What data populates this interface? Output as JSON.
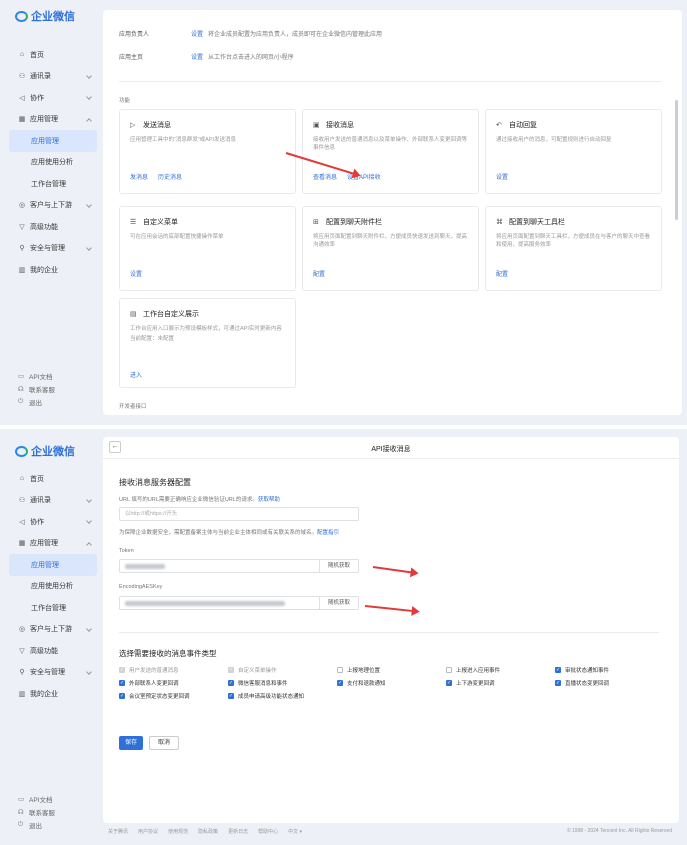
{
  "brand": "企业微信",
  "nav": [
    {
      "label": "首页",
      "icon": "home-icon"
    },
    {
      "label": "通讯录",
      "icon": "contacts-icon"
    },
    {
      "label": "协作",
      "icon": "collab-icon"
    },
    {
      "label": "应用管理",
      "icon": "apps-icon"
    },
    {
      "label": "应用管理",
      "icon": ""
    },
    {
      "label": "应用使用分析",
      "icon": ""
    },
    {
      "label": "工作台管理",
      "icon": ""
    },
    {
      "label": "客户与上下游",
      "icon": "customer-icon"
    },
    {
      "label": "高级功能",
      "icon": "advanced-icon"
    },
    {
      "label": "安全与管理",
      "icon": "security-icon"
    },
    {
      "label": "我的企业",
      "icon": "company-icon"
    }
  ],
  "bottom_links": [
    "API文档",
    "联系客服",
    "退出"
  ],
  "panel1": {
    "owner_label": "应用负责人",
    "owner_link": "设置",
    "owner_desc": "将企业成员配置为应用负责人，成员即可在企业微信内管理此应用",
    "home_label": "应用主页",
    "home_link": "设置",
    "home_desc": "从工作台点击进入的网页/小程序",
    "section_features": "功能",
    "section_dev": "开发者接口",
    "cards": [
      {
        "title": "发送消息",
        "desc": "应用管理工具中的“消息群发”或API发送消息",
        "links": [
          "发消息",
          "历史消息"
        ]
      },
      {
        "title": "接收消息",
        "desc": "接收用户发送的普通消息以及菜单操作、外部联系人变更回调等事件信息",
        "links": [
          "查看消息",
          "设置API接收"
        ]
      },
      {
        "title": "自动回复",
        "desc": "通过接收用户的消息，可配置规则进行自动回复",
        "links": [
          "设置"
        ]
      },
      {
        "title": "自定义菜单",
        "desc": "可在应用会话的底部配置快捷操作菜单",
        "links": [
          "设置"
        ]
      },
      {
        "title": "配置到聊天附件栏",
        "desc": "将应用页面配置到聊天附件栏，方便成员快速发送到聊天，提高沟通效率",
        "links": [
          "配置"
        ]
      },
      {
        "title": "配置到聊天工具栏",
        "desc": "将应用页面配置到聊天工具栏，方便成员在与客户的聊天中查看和使用，提高服务效率",
        "links": [
          "配置"
        ]
      },
      {
        "title": "工作台自定义展示",
        "desc": "工作台应用入口展示为预设模板样式，可通过API实时更新内容",
        "extra": "当前配置：未配置",
        "links": [
          "进入"
        ]
      }
    ]
  },
  "panel2": {
    "title": "API接收消息",
    "heading": "接收消息服务器配置",
    "url_hint": "URL  填写的URL需要正确响应企业微信验证URL的请求。",
    "url_help": "获取帮助",
    "url_placeholder": "以http://或https://开头",
    "domain_note": "为保障企业数据安全，需配置备案主体与当前企业主体相同或有关联关系的域名。",
    "domain_link": "配置指引",
    "token_label": "Token",
    "aes_label": "EncodingAESKey",
    "random_btn": "随机获取",
    "events_heading": "选择需要接收的消息事件类型",
    "events": [
      [
        {
          "label": "用户发送的普通消息",
          "state": "disabled"
        },
        {
          "label": "自定义菜单操作",
          "state": "disabled"
        },
        {
          "label": "上报地理位置",
          "state": "off"
        },
        {
          "label": "上报进入应用事件",
          "state": "off"
        },
        {
          "label": "审批状态通知事件",
          "state": "on"
        }
      ],
      [
        {
          "label": "外部联系人变更回调",
          "state": "on"
        },
        {
          "label": "微信客服消息和事件",
          "state": "on"
        },
        {
          "label": "支付和退款通知",
          "state": "on"
        },
        {
          "label": "上下游变更回调",
          "state": "on"
        },
        {
          "label": "直播状态变更回调",
          "state": "on"
        }
      ],
      [
        {
          "label": "会议室预定状态变更回调",
          "state": "on"
        },
        {
          "label": "成员申请高级功能状态通知",
          "state": "on"
        }
      ]
    ],
    "save": "保存",
    "cancel": "取消",
    "footer_links": [
      "关于腾讯",
      "用户协议",
      "使用规范",
      "隐私政策",
      "更新日志",
      "帮助中心",
      "中文 ▾"
    ],
    "copyright": "© 1998 - 2024 Tencent Inc. All Rights Reserved"
  },
  "colors": {
    "accent": "#2f6fd8",
    "arrow": "#e03a3a",
    "bg": "#edf1f7"
  }
}
